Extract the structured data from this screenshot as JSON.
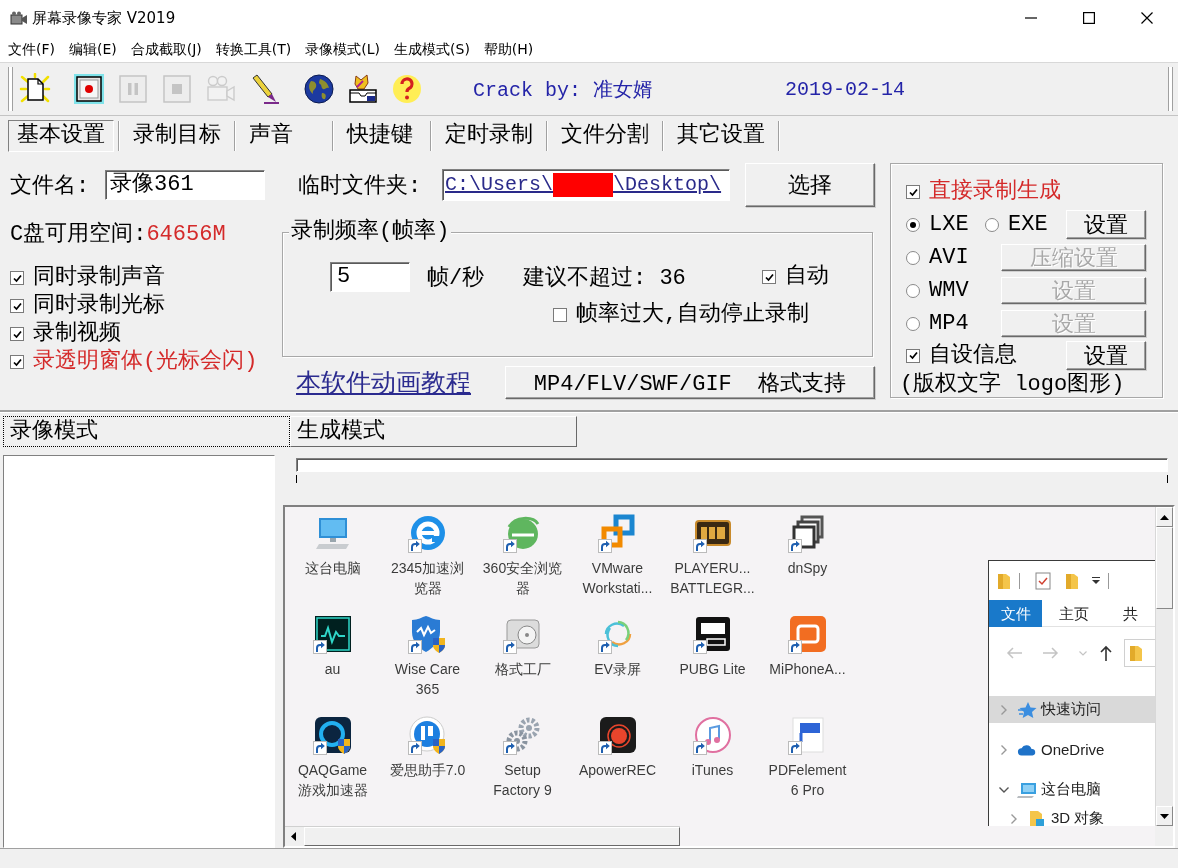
{
  "window": {
    "title": "屏幕录像专家 V2019"
  },
  "menu": [
    "文件(F)",
    "编辑(E)",
    "合成截取(J)",
    "转换工具(T)",
    "录像模式(L)",
    "生成模式(S)",
    "帮助(H)"
  ],
  "toolbar": {
    "buttons": [
      {
        "disabled": false
      },
      {
        "disabled": false
      },
      {
        "disabled": true
      },
      {
        "disabled": true
      },
      {
        "disabled": true
      },
      {
        "disabled": false
      },
      {
        "disabled": false
      },
      {
        "disabled": false
      },
      {
        "disabled": false
      }
    ],
    "credit": "Crack by: 准女婿",
    "date": "2019-02-14"
  },
  "tabs": [
    {
      "label": "基本设置",
      "selected": true
    },
    {
      "label": "录制目标",
      "selected": false
    },
    {
      "label": "声音",
      "selected": false
    },
    {
      "label": "快捷键",
      "selected": false
    },
    {
      "label": "定时录制",
      "selected": false
    },
    {
      "label": "文件分割",
      "selected": false
    },
    {
      "label": "其它设置",
      "selected": false
    }
  ],
  "file_name": {
    "label": "文件名:",
    "value": "录像361"
  },
  "temp_folder": {
    "label": "临时文件夹:",
    "path_start": "C:\\Users\\",
    "path_end": "\\Desktop\\",
    "redacted": true,
    "button": "选择"
  },
  "disk_space": {
    "label": "C盘可用空间:",
    "value": "64656M"
  },
  "options": [
    {
      "label": "同时录制声音",
      "checked": true,
      "color": "#000000"
    },
    {
      "label": "同时录制光标",
      "checked": true,
      "color": "#000000"
    },
    {
      "label": "录制视频",
      "checked": true,
      "color": "#000000"
    },
    {
      "label": "录透明窗体(光标会闪)",
      "checked": true,
      "color": "#d42a2a"
    }
  ],
  "frame_rate": {
    "legend": "录制频率(帧率)",
    "value": "5",
    "unit": "帧/秒",
    "hint": "建议不超过: 36",
    "auto": {
      "label": "自动",
      "checked": true
    },
    "auto_stop": {
      "label": "帧率过大,自动停止录制",
      "checked": false
    }
  },
  "tutorial_link": "本软件动画教程",
  "format_button": "MP4/FLV/SWF/GIF  格式支持",
  "output": {
    "direct": {
      "label": "直接录制生成",
      "checked": true
    },
    "formats": [
      {
        "label": "LXE",
        "selected": true
      },
      {
        "label": "EXE",
        "selected": false
      },
      {
        "label": "AVI",
        "selected": false
      },
      {
        "label": "WMV",
        "selected": false
      },
      {
        "label": "MP4",
        "selected": false
      }
    ],
    "buttons": [
      {
        "label": "设置",
        "disabled": false
      },
      {
        "label": "压缩设置",
        "disabled": true
      },
      {
        "label": "设置",
        "disabled": true
      },
      {
        "label": "设置",
        "disabled": true
      }
    ],
    "custom_info": {
      "label": "自设信息",
      "checked": true,
      "button": {
        "label": "设置",
        "disabled": false
      },
      "note": "(版权文字 logo图形)"
    }
  },
  "mode_tabs": [
    {
      "label": "录像模式",
      "selected": true
    },
    {
      "label": "生成模式",
      "selected": false
    }
  ],
  "preview": {
    "desktop_icons": [
      {
        "label": "这台电脑",
        "shortcut": false
      },
      {
        "label": "2345加速浏览器",
        "shortcut": true
      },
      {
        "label": "360安全浏览器",
        "shortcut": true
      },
      {
        "label": "VMware Workstati...",
        "shortcut": true
      },
      {
        "label": "PLAYERU... BATTLEGR...",
        "shortcut": true
      },
      {
        "label": "dnSpy",
        "shortcut": true
      },
      {
        "label": "au",
        "shortcut": true
      },
      {
        "label": "Wise Care 365",
        "shortcut": true
      },
      {
        "label": "格式工厂",
        "shortcut": true
      },
      {
        "label": "EV录屏",
        "shortcut": true
      },
      {
        "label": "PUBG Lite",
        "shortcut": true
      },
      {
        "label": "MiPhoneA...",
        "shortcut": true
      },
      {
        "label": "QAQGame 游戏加速器",
        "shortcut": true
      },
      {
        "label": "爱思助手7.0",
        "shortcut": true
      },
      {
        "label": "Setup Factory 9",
        "shortcut": true
      },
      {
        "label": "ApowerREC",
        "shortcut": true
      },
      {
        "label": "iTunes",
        "shortcut": true
      },
      {
        "label": "PDFelement 6 Pro",
        "shortcut": true
      }
    ],
    "explorer": {
      "tabs": [
        {
          "label": "文件",
          "selected": true
        },
        {
          "label": "主页",
          "selected": false
        },
        {
          "label": "共",
          "selected": false
        }
      ],
      "nav_buttons": [
        {
          "disabled": true
        },
        {
          "disabled": true
        },
        {
          "disabled": true
        },
        {
          "disabled": false
        }
      ],
      "tree": [
        {
          "label": "快速访问",
          "selected": true,
          "expanded": false
        },
        {
          "label": "OneDrive",
          "selected": false,
          "expanded": false
        },
        {
          "label": "这台电脑",
          "selected": false,
          "expanded": true,
          "children": [
            {
              "label": "3D 对象",
              "selected": false,
              "expanded": false
            }
          ]
        }
      ]
    }
  }
}
